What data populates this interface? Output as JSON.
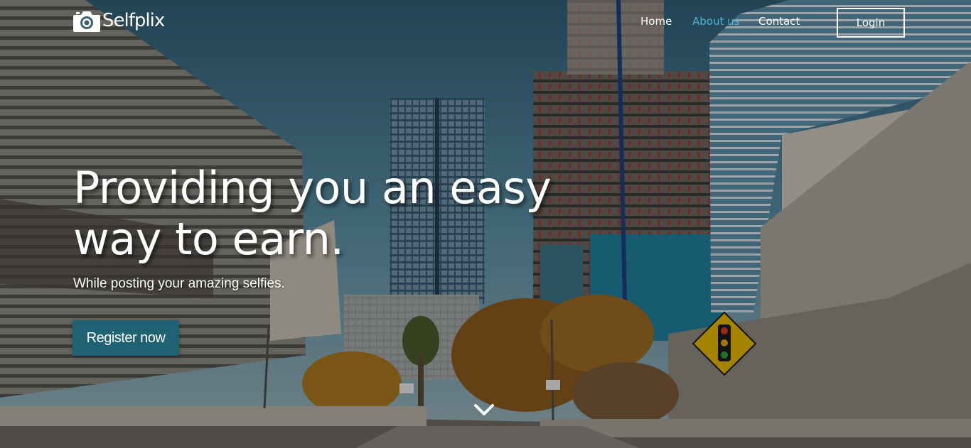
{
  "brand": {
    "name": "Selfplix",
    "logo_icon": "camera-icon"
  },
  "nav": {
    "links": [
      {
        "label": "Home",
        "active": false
      },
      {
        "label": "About us",
        "active": true
      },
      {
        "label": "Contact",
        "active": false
      }
    ],
    "login_label": "Login"
  },
  "hero": {
    "headline": "Providing you an easy way to earn.",
    "subheadline": "While posting your amazing selfies.",
    "cta_label": "Register now",
    "scroll_icon": "chevron-down-icon"
  },
  "colors": {
    "accent": "#4fb3d9",
    "cta_bg": "#1f6273",
    "text": "#ffffff"
  }
}
